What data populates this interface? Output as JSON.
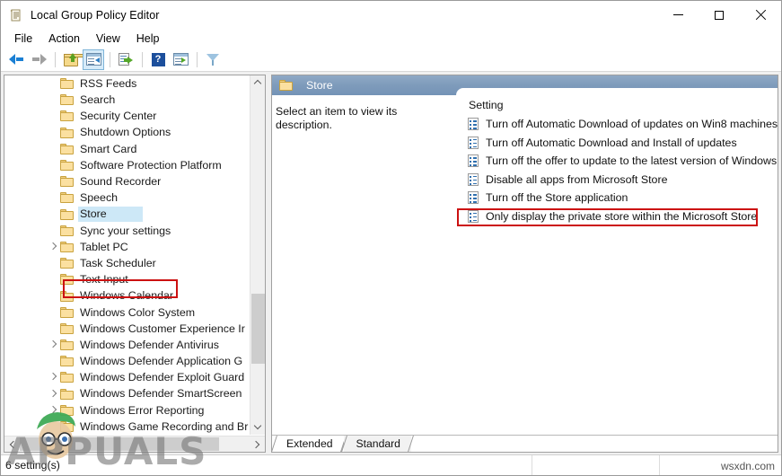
{
  "window": {
    "title": "Local Group Policy Editor",
    "icon": "policy-scroll-icon",
    "minimize_label": "Minimize",
    "maximize_label": "Maximize",
    "close_label": "Close"
  },
  "menubar": {
    "items": [
      {
        "label": "File"
      },
      {
        "label": "Action"
      },
      {
        "label": "View"
      },
      {
        "label": "Help"
      }
    ]
  },
  "toolbar": {
    "buttons": [
      {
        "name": "back-button",
        "icon": "back-arrow-icon"
      },
      {
        "name": "forward-button",
        "icon": "forward-arrow-icon"
      },
      {
        "name": "up-one-level-button",
        "icon": "folder-up-icon"
      },
      {
        "name": "show-hide-tree-button",
        "icon": "console-tree-icon"
      },
      {
        "name": "export-list-button",
        "icon": "export-list-icon"
      },
      {
        "name": "help-button",
        "icon": "help-question-icon"
      },
      {
        "name": "properties-button",
        "icon": "window-properties-icon"
      },
      {
        "name": "filter-button",
        "icon": "filter-funnel-icon"
      }
    ]
  },
  "tree": {
    "items": [
      {
        "label": "RSS Feeds",
        "expandable": false,
        "selected": false
      },
      {
        "label": "Search",
        "expandable": false,
        "selected": false
      },
      {
        "label": "Security Center",
        "expandable": false,
        "selected": false
      },
      {
        "label": "Shutdown Options",
        "expandable": false,
        "selected": false
      },
      {
        "label": "Smart Card",
        "expandable": false,
        "selected": false
      },
      {
        "label": "Software Protection Platform",
        "expandable": false,
        "selected": false
      },
      {
        "label": "Sound Recorder",
        "expandable": false,
        "selected": false
      },
      {
        "label": "Speech",
        "expandable": false,
        "selected": false
      },
      {
        "label": "Store",
        "expandable": false,
        "selected": true
      },
      {
        "label": "Sync your settings",
        "expandable": false,
        "selected": false
      },
      {
        "label": "Tablet PC",
        "expandable": true,
        "selected": false
      },
      {
        "label": "Task Scheduler",
        "expandable": false,
        "selected": false
      },
      {
        "label": "Text Input",
        "expandable": false,
        "selected": false
      },
      {
        "label": "Windows Calendar",
        "expandable": false,
        "selected": false
      },
      {
        "label": "Windows Color System",
        "expandable": false,
        "selected": false
      },
      {
        "label": "Windows Customer Experience Ir",
        "expandable": false,
        "selected": false
      },
      {
        "label": "Windows Defender Antivirus",
        "expandable": true,
        "selected": false
      },
      {
        "label": "Windows Defender Application G",
        "expandable": false,
        "selected": false
      },
      {
        "label": "Windows Defender Exploit Guard",
        "expandable": true,
        "selected": false
      },
      {
        "label": "Windows Defender SmartScreen",
        "expandable": true,
        "selected": false
      },
      {
        "label": "Windows Error Reporting",
        "expandable": true,
        "selected": false
      },
      {
        "label": "Windows Game Recording and Br",
        "expandable": false,
        "selected": false
      }
    ],
    "scroll_up_icon": "chevron-up-icon",
    "scroll_down_icon": "chevron-down-icon",
    "scroll_left_icon": "chevron-left-icon",
    "scroll_right_icon": "chevron-right-icon"
  },
  "right_pane": {
    "header_title": "Store",
    "header_icon": "folder-icon",
    "description": "Select an item to view its description.",
    "column_header": "Setting",
    "settings": [
      {
        "label": "Turn off Automatic Download of updates on Win8 machines",
        "highlighted": false
      },
      {
        "label": "Turn off Automatic Download and Install of updates",
        "highlighted": true
      },
      {
        "label": "Turn off the offer to update to the latest version of Windows",
        "highlighted": false
      },
      {
        "label": "Disable all apps from Microsoft Store",
        "highlighted": false
      },
      {
        "label": "Turn off the Store application",
        "highlighted": false
      },
      {
        "label": "Only display the private store within the Microsoft Store",
        "highlighted": false
      }
    ],
    "tabs": [
      {
        "label": "Extended",
        "active": false
      },
      {
        "label": "Standard",
        "active": true
      }
    ]
  },
  "statusbar": {
    "text": "6 setting(s)"
  },
  "watermark": {
    "brand": "APPUALS",
    "source": "wsxdn.com"
  },
  "colors": {
    "header_blue": "#7e9bbb",
    "highlight_red": "#cc1111",
    "selection_blue": "#cde8f7",
    "folder_yellow": "#fbe0a0"
  }
}
